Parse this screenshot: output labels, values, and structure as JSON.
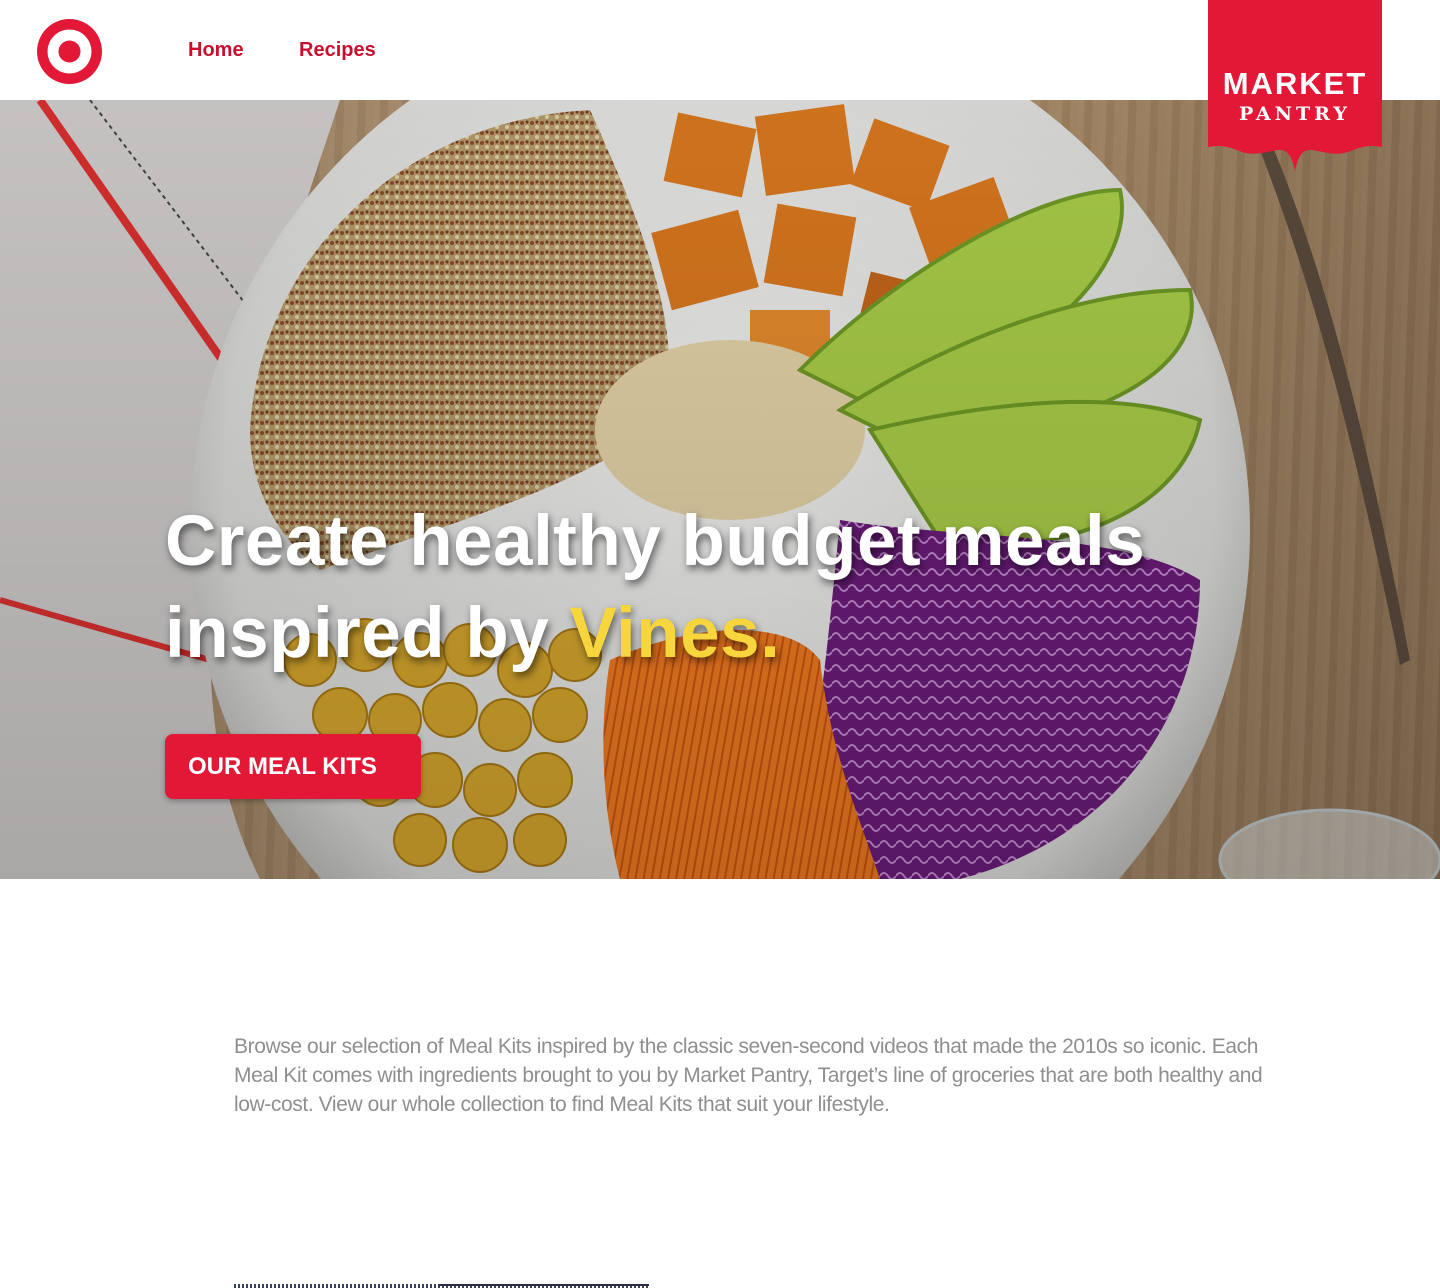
{
  "header": {
    "logo_icon": "target-bullseye-icon",
    "nav": [
      {
        "label": "Home"
      },
      {
        "label": "Recipes"
      }
    ],
    "badge": {
      "line1": "MARKET",
      "line2": "PANTRY"
    }
  },
  "hero": {
    "headline_part1": "Create healthy budget meals inspired by ",
    "headline_accent": "Vines.",
    "cta_label": "OUR MEAL KITS"
  },
  "intro": {
    "text": "Browse our selection of Meal Kits inspired by the classic seven-second videos that made the 2010s so iconic. Each Meal Kit comes with ingredients brought to you by Market Pantry, Target’s line of groceries that are both healthy and low-cost. View our whole collection to find Meal Kits that suit your lifestyle."
  },
  "colors": {
    "brand_red": "#e31837",
    "nav_red": "#c8102e",
    "accent_yellow": "#f6d63c",
    "body_text_gray": "#8f8f8f"
  }
}
